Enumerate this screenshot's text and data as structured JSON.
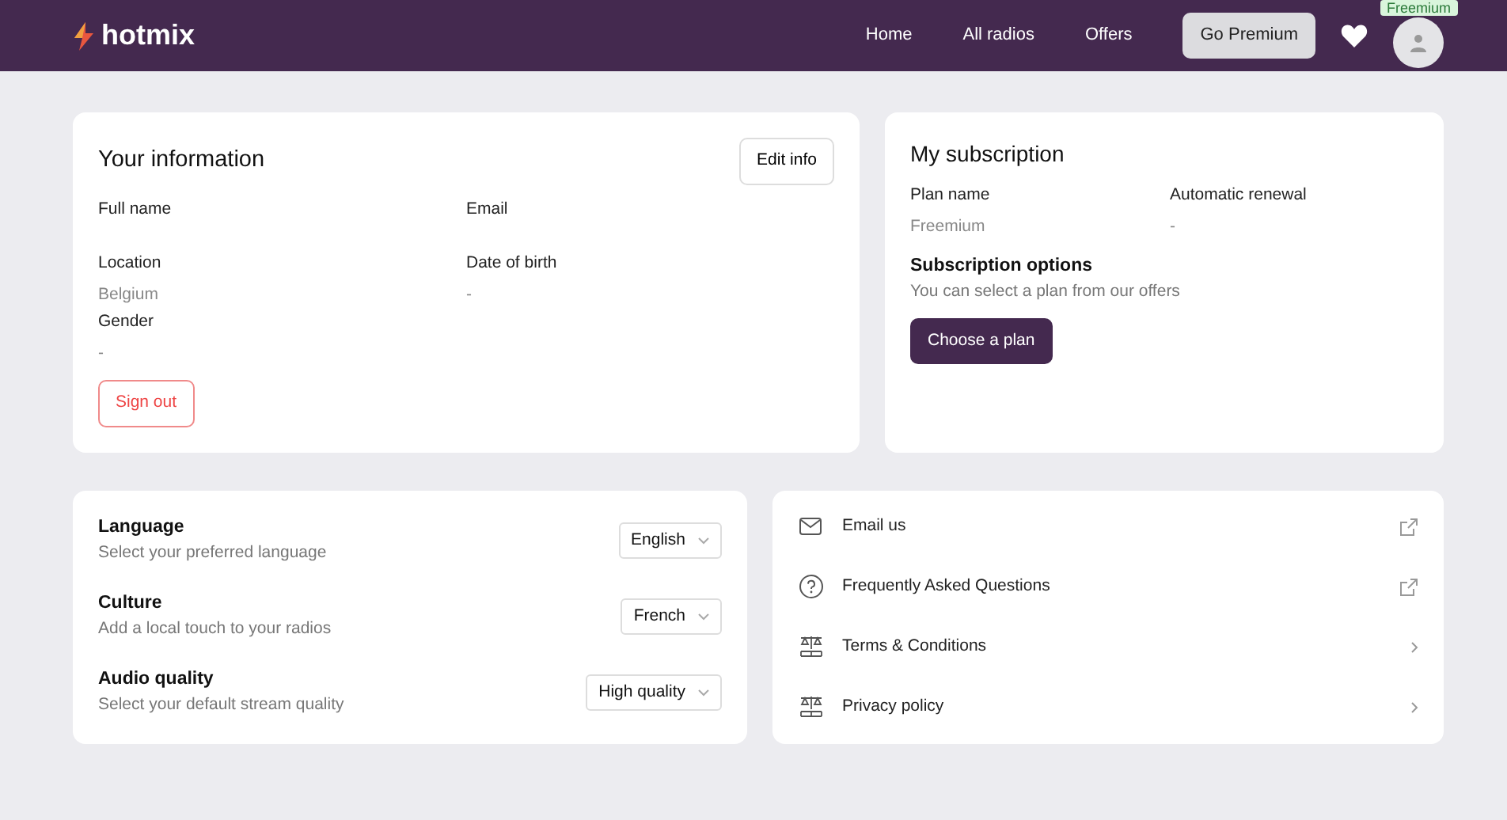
{
  "header": {
    "logo": "hotmix",
    "nav": [
      {
        "label": "Home"
      },
      {
        "label": "All radios"
      },
      {
        "label": "Offers"
      }
    ],
    "cta": "Go Premium",
    "plan_badge": "Freemium"
  },
  "info": {
    "title": "Your information",
    "edit": "Edit info",
    "fields": [
      {
        "label": "Full name"
      },
      {
        "label": "Email"
      },
      {
        "label": "Location",
        "value": "Belgium"
      },
      {
        "label": "Date of birth",
        "value": "-"
      },
      {
        "label": "Gender",
        "value": "-"
      }
    ],
    "signout": "Sign out"
  },
  "subscription": {
    "title": "My subscription",
    "fields": [
      {
        "label": "Plan name",
        "value": "Freemium"
      },
      {
        "label": "Automatic renewal",
        "value": "-"
      }
    ],
    "options_title": "Subscription options",
    "options_text": "You can select a plan from our offers",
    "choose": "Choose a plan"
  },
  "settings": [
    {
      "title": "Language",
      "subtitle": "Select your preferred language",
      "value": "English"
    },
    {
      "title": "Culture",
      "subtitle": "Add a local touch to your radios",
      "value": "French"
    },
    {
      "title": "Audio quality",
      "subtitle": "Select your default stream quality",
      "value": "High quality"
    }
  ],
  "links": [
    {
      "label": "Email us",
      "kind": "external"
    },
    {
      "label": "Frequently Asked Questions",
      "kind": "external"
    },
    {
      "label": "Terms & Conditions",
      "kind": "internal"
    },
    {
      "label": "Privacy policy",
      "kind": "internal"
    }
  ]
}
